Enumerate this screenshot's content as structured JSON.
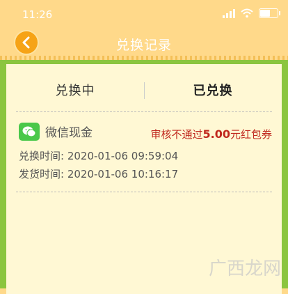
{
  "status_bar": {
    "time": "11:26",
    "battery": "20"
  },
  "header": {
    "title": "兑换记录"
  },
  "tabs": [
    {
      "label": "兑换中",
      "active": false
    },
    {
      "label": "已兑换",
      "active": true
    }
  ],
  "record": {
    "method": "微信现金",
    "result_prefix": "审核不通过",
    "amount": "5.00",
    "result_suffix": "元红包券",
    "exchange_label": "兑换时间: ",
    "exchange_time": "2020-01-06 09:59:04",
    "delivery_label": "发货时间: ",
    "delivery_time": "2020-01-06 10:16:17"
  },
  "watermark": "广西龙网",
  "colors": {
    "header_bg": "#ffd98a",
    "frame_green": "#8bc53f",
    "card_bg": "#fff8d4",
    "alert_red": "#c0281e",
    "back_orange": "#f6a316"
  }
}
